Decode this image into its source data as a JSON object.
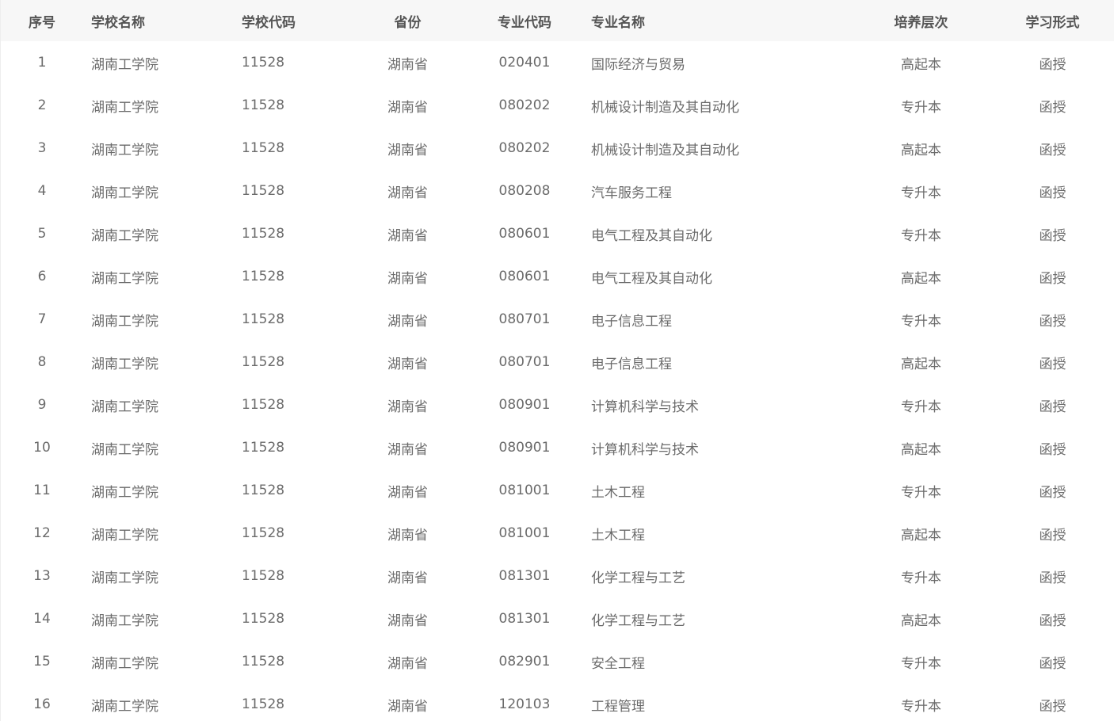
{
  "headers": {
    "index": "序号",
    "school_name": "学校名称",
    "school_code": "学校代码",
    "province": "省份",
    "major_code": "专业代码",
    "major_name": "专业名称",
    "level": "培养层次",
    "mode": "学习形式"
  },
  "rows": [
    {
      "index": "1",
      "school_name": "湖南工学院",
      "school_code": "11528",
      "province": "湖南省",
      "major_code": "020401",
      "major_name": "国际经济与贸易",
      "level": "高起本",
      "mode": "函授"
    },
    {
      "index": "2",
      "school_name": "湖南工学院",
      "school_code": "11528",
      "province": "湖南省",
      "major_code": "080202",
      "major_name": "机械设计制造及其自动化",
      "level": "专升本",
      "mode": "函授"
    },
    {
      "index": "3",
      "school_name": "湖南工学院",
      "school_code": "11528",
      "province": "湖南省",
      "major_code": "080202",
      "major_name": "机械设计制造及其自动化",
      "level": "高起本",
      "mode": "函授"
    },
    {
      "index": "4",
      "school_name": "湖南工学院",
      "school_code": "11528",
      "province": "湖南省",
      "major_code": "080208",
      "major_name": "汽车服务工程",
      "level": "专升本",
      "mode": "函授"
    },
    {
      "index": "5",
      "school_name": "湖南工学院",
      "school_code": "11528",
      "province": "湖南省",
      "major_code": "080601",
      "major_name": "电气工程及其自动化",
      "level": "专升本",
      "mode": "函授"
    },
    {
      "index": "6",
      "school_name": "湖南工学院",
      "school_code": "11528",
      "province": "湖南省",
      "major_code": "080601",
      "major_name": "电气工程及其自动化",
      "level": "高起本",
      "mode": "函授"
    },
    {
      "index": "7",
      "school_name": "湖南工学院",
      "school_code": "11528",
      "province": "湖南省",
      "major_code": "080701",
      "major_name": "电子信息工程",
      "level": "专升本",
      "mode": "函授"
    },
    {
      "index": "8",
      "school_name": "湖南工学院",
      "school_code": "11528",
      "province": "湖南省",
      "major_code": "080701",
      "major_name": "电子信息工程",
      "level": "高起本",
      "mode": "函授"
    },
    {
      "index": "9",
      "school_name": "湖南工学院",
      "school_code": "11528",
      "province": "湖南省",
      "major_code": "080901",
      "major_name": "计算机科学与技术",
      "level": "专升本",
      "mode": "函授"
    },
    {
      "index": "10",
      "school_name": "湖南工学院",
      "school_code": "11528",
      "province": "湖南省",
      "major_code": "080901",
      "major_name": "计算机科学与技术",
      "level": "高起本",
      "mode": "函授"
    },
    {
      "index": "11",
      "school_name": "湖南工学院",
      "school_code": "11528",
      "province": "湖南省",
      "major_code": "081001",
      "major_name": "土木工程",
      "level": "专升本",
      "mode": "函授"
    },
    {
      "index": "12",
      "school_name": "湖南工学院",
      "school_code": "11528",
      "province": "湖南省",
      "major_code": "081001",
      "major_name": "土木工程",
      "level": "高起本",
      "mode": "函授"
    },
    {
      "index": "13",
      "school_name": "湖南工学院",
      "school_code": "11528",
      "province": "湖南省",
      "major_code": "081301",
      "major_name": "化学工程与工艺",
      "level": "专升本",
      "mode": "函授"
    },
    {
      "index": "14",
      "school_name": "湖南工学院",
      "school_code": "11528",
      "province": "湖南省",
      "major_code": "081301",
      "major_name": "化学工程与工艺",
      "level": "高起本",
      "mode": "函授"
    },
    {
      "index": "15",
      "school_name": "湖南工学院",
      "school_code": "11528",
      "province": "湖南省",
      "major_code": "082901",
      "major_name": "安全工程",
      "level": "专升本",
      "mode": "函授"
    },
    {
      "index": "16",
      "school_name": "湖南工学院",
      "school_code": "11528",
      "province": "湖南省",
      "major_code": "120103",
      "major_name": "工程管理",
      "level": "专升本",
      "mode": "函授"
    }
  ]
}
